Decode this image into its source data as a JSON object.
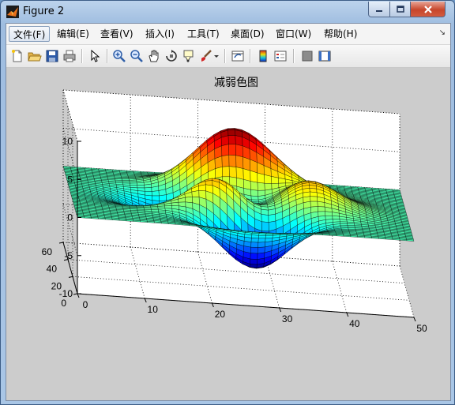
{
  "window": {
    "title": "Figure 2"
  },
  "menu": [
    "文件(F)",
    "编辑(E)",
    "查看(V)",
    "插入(I)",
    "工具(T)",
    "桌面(D)",
    "窗口(W)",
    "帮助(H)"
  ],
  "toolbar_icons": [
    "new-figure-icon",
    "open-file-icon",
    "save-icon",
    "print-icon",
    "edit-plot-arrow-icon",
    "zoom-in-icon",
    "zoom-out-icon",
    "pan-hand-icon",
    "rotate-3d-icon",
    "data-cursor-icon",
    "brush-icon",
    "brush-dropdown-icon",
    "link-plot-icon",
    "insert-colorbar-icon",
    "insert-legend-icon",
    "hide-plot-tools-icon",
    "show-plot-tools-icon"
  ],
  "plot": {
    "title": "减弱色图",
    "z_ticks": [
      "10",
      "5",
      "0",
      "-5",
      "-10"
    ],
    "y_ticks": [
      "60",
      "40",
      "20",
      "0"
    ],
    "x_ticks": [
      "0",
      "10",
      "20",
      "30",
      "40",
      "50"
    ]
  },
  "chart_data": {
    "type": "surface",
    "title": "减弱色图",
    "x_range": [
      0,
      50
    ],
    "y_range": [
      0,
      60
    ],
    "z_range": [
      -10,
      10
    ],
    "x_ticks": [
      0,
      10,
      20,
      30,
      40,
      50
    ],
    "y_ticks": [
      0,
      20,
      40,
      60
    ],
    "z_ticks": [
      -10,
      -5,
      0,
      5,
      10
    ],
    "grid": true,
    "colormap": "jet",
    "function": "peaks",
    "extrema": {
      "max": 8.1,
      "min": -6.5
    },
    "colors": {
      "figure_bg": "#cccccc",
      "axes_bg": "#ffffff",
      "mesh": "#000000"
    }
  }
}
